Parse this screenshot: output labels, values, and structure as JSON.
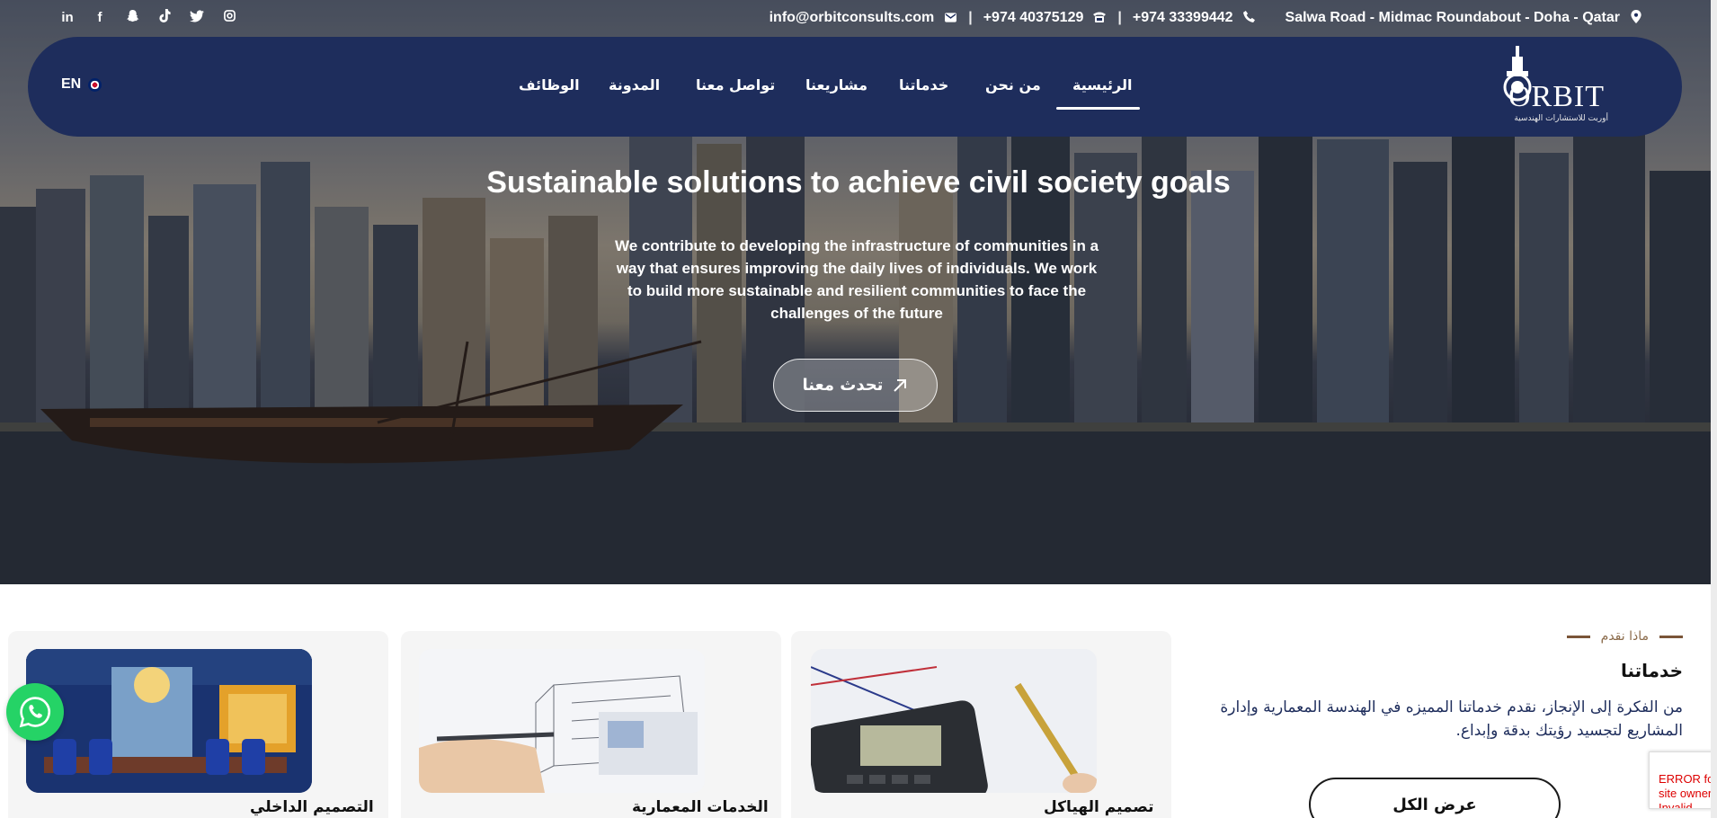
{
  "topbar": {
    "social": [
      "in",
      "f",
      "👻",
      "♪",
      "🐦",
      "◎"
    ],
    "email": "info@orbitconsults.com",
    "phone1": "+974 40375129",
    "phone2": "+974 33399442",
    "address": "Salwa Road - Midmac Roundabout - Doha - Qatar"
  },
  "nav": {
    "logo_word": "ORBIT",
    "logo_sub": "أوربت للاستشارات الهندسية",
    "items": {
      "home": "الرئيسية",
      "about": "من نحن",
      "services": "خدماتنا",
      "projects": "مشاريعنا",
      "contact": "تواصل معنا",
      "blog": "المدونة",
      "jobs": "الوظائف"
    },
    "lang": "EN"
  },
  "hero": {
    "title": "Sustainable solutions to achieve civil society goals",
    "text": "We contribute to developing the infrastructure of communities in a way that ensures improving the daily lives of individuals. We work to build more sustainable and resilient communities to face the challenges of the future",
    "button": "تحدث معنا"
  },
  "services": {
    "eyebrow": "ماذا نقدم",
    "title": "خدماتنا",
    "description": "من الفكرة إلى الإنجاز، نقدم خدماتنا المميزه في الهندسة المعمارية وإدارة المشاريع لتجسيد رؤيتك بدقة وإبداع.",
    "view_all": "عرض الكل",
    "cards": {
      "structural": "تصميم الهياكل",
      "architectural": "الخدمات المعمارية",
      "interior": "التصميم الداخلي"
    }
  },
  "recaptcha": "ERROR for site owner: Invalid domain"
}
